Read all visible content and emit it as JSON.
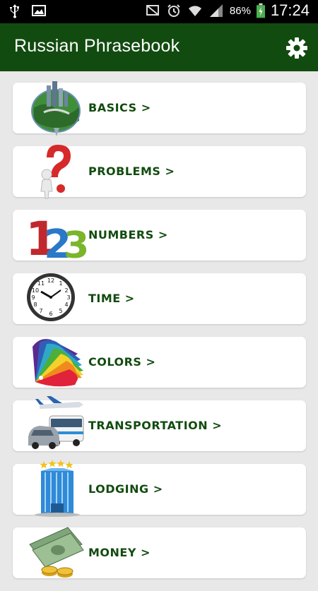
{
  "status_bar": {
    "icons_left": [
      "usb-icon",
      "image-icon"
    ],
    "icons_right": [
      "mute-notifications-icon",
      "alarm-icon",
      "wifi-icon",
      "signal-icon",
      "battery-charging-icon"
    ],
    "battery": "86%",
    "time": "17:24"
  },
  "app_bar": {
    "title": "Russian Phrasebook",
    "settings_icon": "gear-icon"
  },
  "categories": [
    {
      "label": "BASICS >",
      "icon": "globe-icon"
    },
    {
      "label": "PROBLEMS >",
      "icon": "question-mark-icon"
    },
    {
      "label": "NUMBERS >",
      "icon": "numbers-123-icon"
    },
    {
      "label": "TIME >",
      "icon": "clock-icon"
    },
    {
      "label": "COLORS >",
      "icon": "color-swatch-icon"
    },
    {
      "label": "TRANSPORTATION >",
      "icon": "vehicles-icon"
    },
    {
      "label": "LODGING >",
      "icon": "hotel-icon"
    },
    {
      "label": "MONEY >",
      "icon": "money-icon"
    }
  ],
  "colors": {
    "app_bar": "#124b0f",
    "label_text": "#124b0f",
    "background": "#e8e8e8"
  }
}
